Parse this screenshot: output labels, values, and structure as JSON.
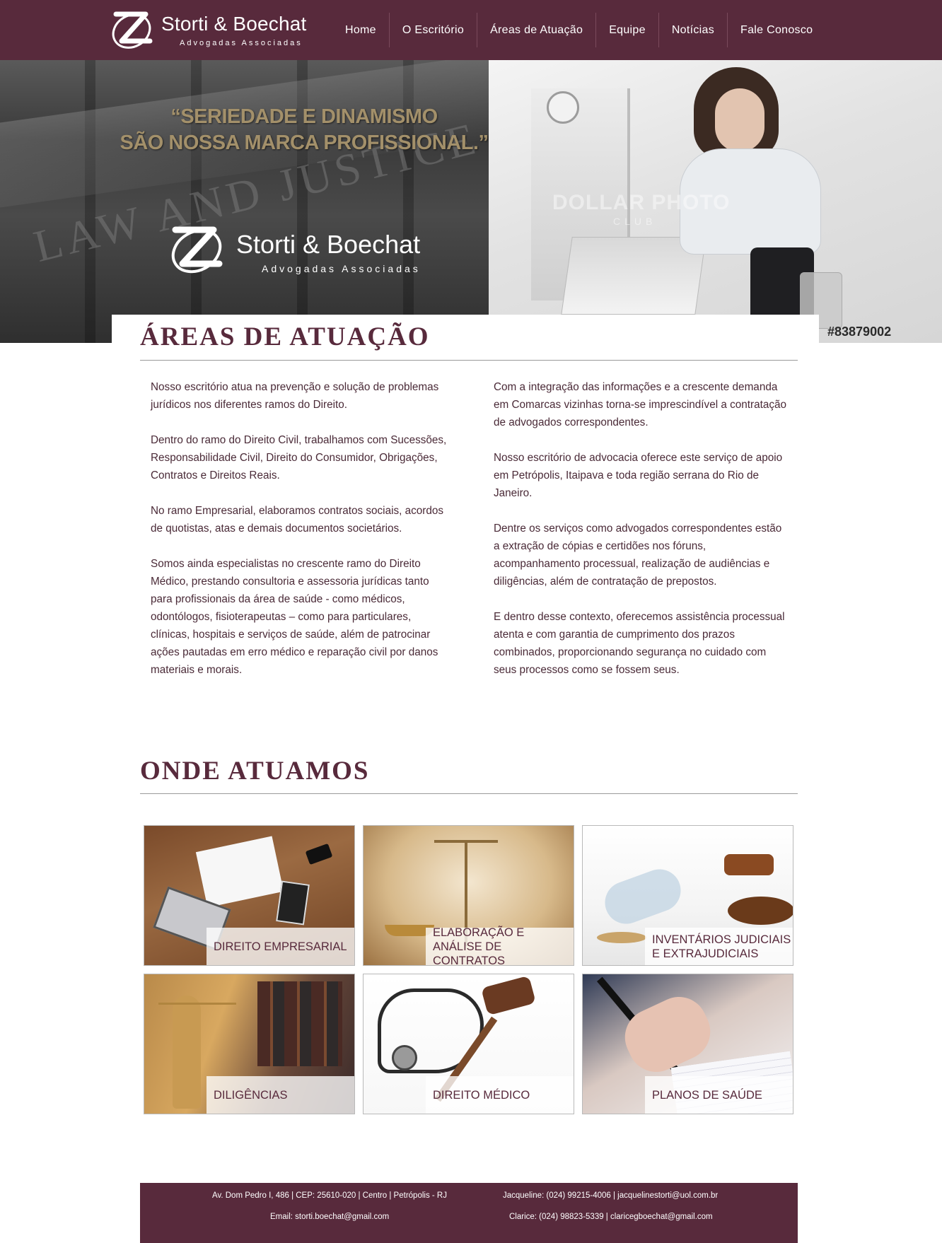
{
  "header": {
    "logo_name": "Storti & Boechat",
    "logo_sub": "Advogadas Associadas",
    "nav": [
      "Home",
      "O Escritório",
      "Áreas de Atuação",
      "Equipe",
      "Notícias",
      "Fale Conosco"
    ]
  },
  "hero": {
    "quote_line1": "“SERIEDADE E DINAMISMO",
    "quote_line2": "SÃO NOSSA MARCA PROFISSIONAL.”",
    "carved_text": "LAW AND JUSTICE",
    "logo_name": "Storti & Boechat",
    "logo_sub": "Advogadas Associadas",
    "watermark": "DOLLAR PHOTO",
    "watermark_sub": "CLUB",
    "stock_id": "#83879002"
  },
  "areas": {
    "title": "ÁREAS DE ATUAÇÃO",
    "left": [
      "Nosso escritório atua na prevenção e solução de problemas jurídicos nos diferentes ramos do Direito.",
      "Dentro do ramo do Direito Civil, trabalhamos com Sucessões, Responsabilidade Civil, Direito do Consumidor, Obrigações, Contratos e Direitos Reais.",
      "No ramo Empresarial, elaboramos contratos sociais, acordos de quotistas, atas e demais documentos societários.",
      "Somos ainda especialistas no crescente ramo do Direito Médico, prestando consultoria e assessoria jurídicas tanto para profissionais da área de saúde - como médicos, odontólogos, fisioterapeutas – como para particulares, clínicas, hospitais e serviços de saúde, além de patrocinar ações pautadas em erro médico e reparação civil por danos materiais e morais."
    ],
    "right": [
      "Com a integração das informações e a crescente demanda em Comarcas vizinhas torna-se imprescindível a contratação de advogados correspondentes.",
      "Nosso escritório de advocacia oferece este serviço de apoio em Petrópolis, Itaipava e toda região serrana do Rio de Janeiro.",
      "Dentre os serviços como advogados correspondentes estão a extração de cópias e certidões nos fóruns, acompanhamento processual, realização de audiências e diligências, além de contratação de prepostos.",
      "E dentro desse contexto, oferecemos assistência processual atenta e com garantia de cumprimento dos prazos combinados, proporcionando segurança no cuidado com seus processos como se fossem seus."
    ]
  },
  "onde": {
    "title": "ONDE ATUAMOS",
    "tiles": [
      {
        "label": "Direito Empresarial"
      },
      {
        "label": "Elaboração e Análise de Contratos"
      },
      {
        "label": "Inventários Judiciais e Extrajudiciais"
      },
      {
        "label": "Diligências"
      },
      {
        "label": "Direito Médico"
      },
      {
        "label": "Planos de Saúde"
      }
    ]
  },
  "footer": {
    "address": "Av. Dom Pedro I, 486 | CEP: 25610-020 | Centro | Petrópolis - RJ",
    "email": "Email: storti.boechat@gmail.com",
    "contact1": "Jacqueline: (024) 99215-4006 | jacquelinestorti@uol.com.br",
    "contact2": "Clarice: (024) 98823-5339 | claricegboechat@gmail.com"
  },
  "colors": {
    "brand": "#582a3c",
    "quote_gold": "#a3906a",
    "body_text": "#4a2a37"
  }
}
